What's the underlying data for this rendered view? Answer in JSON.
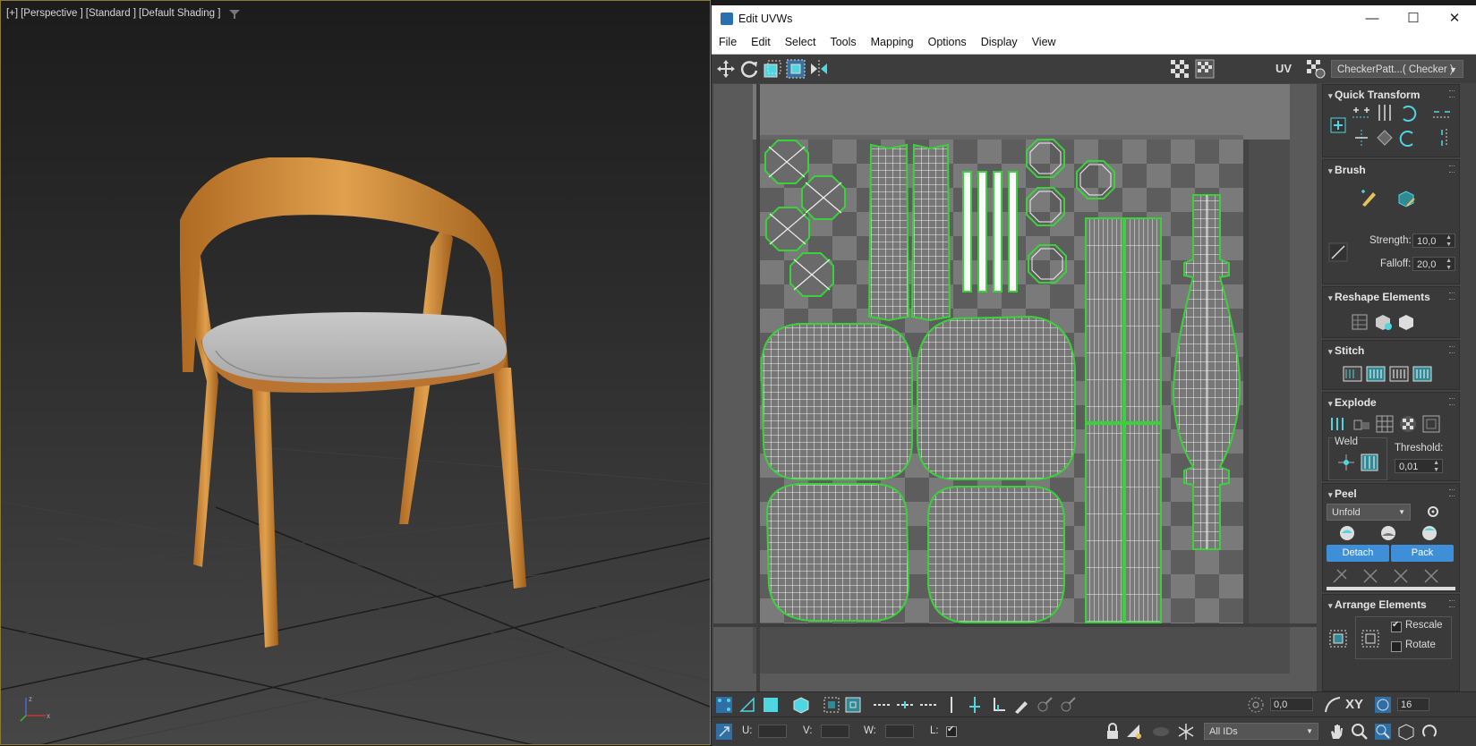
{
  "viewport": {
    "labels": [
      "[+]",
      "[Perspective ]",
      "[Standard ]",
      "[Default Shading ]"
    ],
    "filter_icon": "filter-icon",
    "axis_labels": {
      "x": "x",
      "y": "y",
      "z": "z"
    }
  },
  "window": {
    "title": "Edit UVWs",
    "minimize": "—",
    "maximize": "☐",
    "close": "✕"
  },
  "menu": [
    "File",
    "Edit",
    "Select",
    "Tools",
    "Mapping",
    "Options",
    "Display",
    "View"
  ],
  "toolbar": {
    "uv_label": "UV",
    "texture_select": "CheckerPatt...( Checker )"
  },
  "panel": {
    "quick_transform": {
      "title": "Quick Transform"
    },
    "brush": {
      "title": "Brush",
      "strength_label": "Strength:",
      "strength_value": "10,0",
      "falloff_label": "Falloff:",
      "falloff_value": "20,0"
    },
    "reshape": {
      "title": "Reshape Elements"
    },
    "stitch": {
      "title": "Stitch"
    },
    "explode": {
      "title": "Explode",
      "weld_label": "Weld",
      "threshold_label": "Threshold:",
      "threshold_value": "0,01"
    },
    "peel": {
      "title": "Peel",
      "mode": "Unfold",
      "detach": "Detach",
      "pack": "Pack"
    },
    "arrange": {
      "title": "Arrange Elements",
      "rescale": "Rescale",
      "rotate": "Rotate",
      "rescale_checked": true,
      "rotate_checked": false
    }
  },
  "bottom": {
    "angle_value": "0,0",
    "xy_label": "XY",
    "grid_value": "16",
    "u_label": "U:",
    "v_label": "V:",
    "w_label": "W:",
    "l_label": "L:",
    "ids_select": "All IDs"
  },
  "colors": {
    "accent": "#3f8fd8",
    "uv_edge": "#3ad23a",
    "cyan_icon": "#4fd6e0"
  }
}
